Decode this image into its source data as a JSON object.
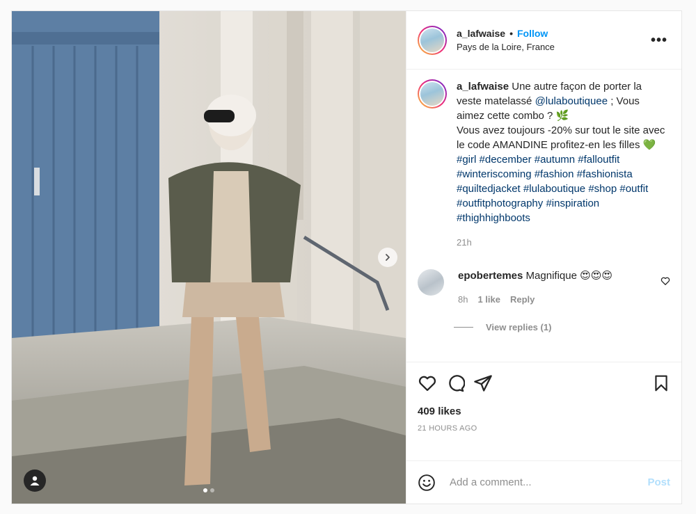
{
  "post": {
    "author": "a_lafwaise",
    "follow_label": "Follow",
    "separator": "•",
    "location": "Pays de la Loire, France",
    "more_label": "•••"
  },
  "caption": {
    "author": "a_lafwaise",
    "text_1": " Une autre façon de porter la veste matelassé ",
    "mention": "@lulaboutiquee",
    "text_2": " ; Vous aimez cette combo ? 🌿",
    "text_3": "Vous avez toujours -20% sur tout le site avec le code AMANDINE profitez-en les filles 💚",
    "hashtags": [
      "#girl",
      "#december",
      "#autumn",
      "#falloutfit",
      "#winteriscoming",
      "#fashion",
      "#fashionista",
      "#quiltedjacket",
      "#lulaboutique",
      "#shop",
      "#outfit",
      "#outfitphotography",
      "#inspiration",
      "#thighhighboots"
    ],
    "time": "21h"
  },
  "comment": {
    "author": "epobertemes",
    "text": " Magnifique 😍😍😍",
    "time": "8h",
    "likes": "1 like",
    "reply_label": "Reply",
    "view_replies": "View replies (1)"
  },
  "stats": {
    "likes": "409 likes",
    "time_ago": "21 HOURS AGO"
  },
  "composer": {
    "placeholder": "Add a comment...",
    "post_label": "Post"
  },
  "carousel": {
    "total": 2,
    "active": 0
  },
  "colors": {
    "accent": "#0095f6",
    "link": "#00376b",
    "muted": "#8e8e8e",
    "post_disabled": "#b2dffc"
  },
  "icons": [
    "user-tag-icon",
    "chevron-right-icon",
    "heart-icon",
    "comment-icon",
    "share-icon",
    "bookmark-icon",
    "emoji-icon",
    "more-icon"
  ]
}
